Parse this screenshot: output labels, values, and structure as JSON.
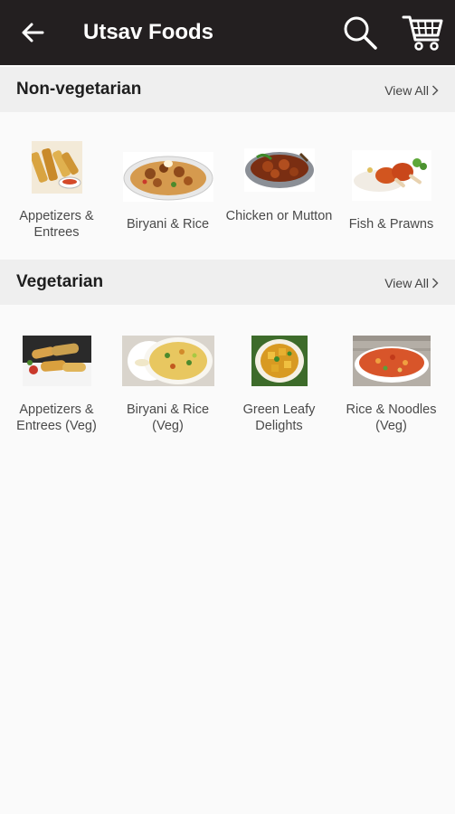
{
  "appbar": {
    "title": "Utsav Foods",
    "back_icon": "arrow-left-icon",
    "search_icon": "search-icon",
    "cart_icon": "cart-icon",
    "background": "#231f20"
  },
  "sections": [
    {
      "title": "Non-vegetarian",
      "view_all": "View All",
      "items": [
        {
          "label": "Appetizers & Entrees",
          "image": "appetizers-image"
        },
        {
          "label": "Biryani & Rice",
          "image": "biryani-image"
        },
        {
          "label": "Chicken or Mutton",
          "image": "chicken-curry-image"
        },
        {
          "label": "Fish & Prawns",
          "image": "fish-prawns-image"
        }
      ]
    },
    {
      "title": "Vegetarian",
      "view_all": "View All",
      "items": [
        {
          "label": "Appetizers & Entrees (Veg)",
          "image": "veg-appetizers-image"
        },
        {
          "label": "Biryani & Rice (Veg)",
          "image": "veg-biryani-image"
        },
        {
          "label": "Green Leafy Delights",
          "image": "green-leafy-image"
        },
        {
          "label": "Rice & Noodles (Veg)",
          "image": "rice-noodles-image"
        }
      ]
    }
  ]
}
